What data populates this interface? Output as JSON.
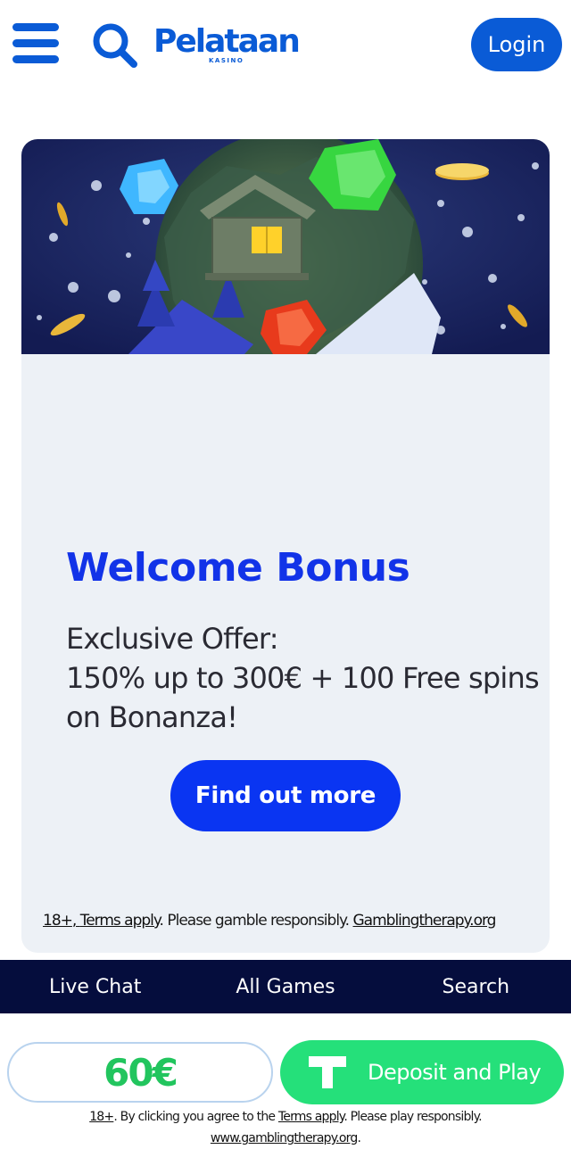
{
  "header": {
    "brand_name": "Pelataan",
    "brand_sub": "KASINO",
    "login_label": "Login",
    "menu_icon": "hamburger-icon",
    "search_icon": "search-icon"
  },
  "promo": {
    "title": "Welcome Bonus",
    "line1": "Exclusive Offer:",
    "line2": "150% up to 300€ + 100 Free spins",
    "line3": "on Bonanza!",
    "cta_label": "Find out more",
    "disclaimer": {
      "age": "18+",
      "terms": "Terms apply",
      "text": ". Please gamble responsibly. ",
      "link": "Gamblingtherapy.org"
    }
  },
  "bottom_nav": {
    "items": [
      {
        "label": "Live Chat"
      },
      {
        "label": "All Games"
      },
      {
        "label": "Search"
      }
    ]
  },
  "deposit": {
    "amount": "60€",
    "button_label": "Deposit and Play",
    "disclaimer": {
      "age": "18+",
      "text_before": ". By clicking you agree to the ",
      "terms": "Terms apply",
      "text_after": ". Please play responsibly.",
      "link": "www.gamblingtherapy.org",
      "end": "."
    }
  },
  "colors": {
    "brand_blue": "#0a5bd6",
    "cta_blue": "#0a35f2",
    "nav_bg": "#050d3d",
    "deposit_green": "#25e07a",
    "amount_green": "#22c55e",
    "card_bg": "#edf1f6"
  }
}
